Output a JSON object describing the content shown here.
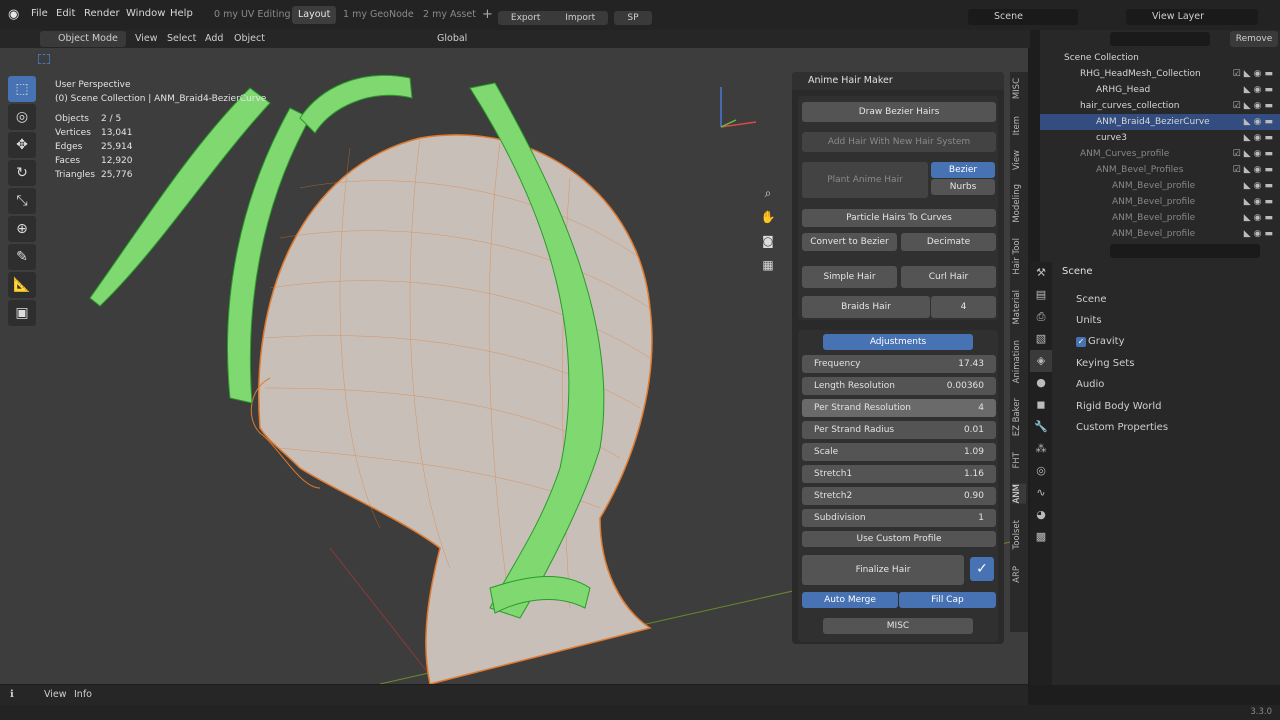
{
  "app": {
    "blender_icon": "blender-logo-icon",
    "version": "3.3.0"
  },
  "menu": [
    "File",
    "Edit",
    "Render",
    "Window",
    "Help"
  ],
  "workspaces": [
    {
      "label": "0 my UV Editing",
      "active": false
    },
    {
      "label": "Layout",
      "active": true
    },
    {
      "label": "1 my GeoNode",
      "active": false
    },
    {
      "label": "2 my Asset",
      "active": false
    }
  ],
  "top_buttons": {
    "add": "+",
    "export": "Export",
    "import": "Import",
    "sp": "SP"
  },
  "scene_selector": {
    "label": "Scene"
  },
  "view_layer": {
    "label": "View Layer"
  },
  "outliner_search_placeholder": "",
  "remove_label": "Remove",
  "viewport_header": {
    "mode": "Object Mode",
    "menus": [
      "View",
      "Select",
      "Add",
      "Object"
    ],
    "transform": "Global"
  },
  "stats": {
    "perspective": "User Perspective",
    "collection": "(0) Scene Collection | ANM_Braid4-BezierCurve",
    "rows": [
      [
        "Objects",
        "2 / 5"
      ],
      [
        "Vertices",
        "13,041"
      ],
      [
        "Edges",
        "25,914"
      ],
      [
        "Faces",
        "12,920"
      ],
      [
        "Triangles",
        "25,776"
      ]
    ]
  },
  "panel": {
    "title": "Anime Hair Maker",
    "draw_bezier": "Draw Bezier Hairs",
    "add_hair": "Add Hair With New Hair System",
    "plant": "Plant Anime Hair",
    "bezier": "Bezier",
    "nurbs": "Nurbs",
    "particle": "Particle Hairs To Curves",
    "convert": "Convert to Bezier",
    "decimate": "Decimate",
    "simple": "Simple Hair",
    "curl": "Curl Hair",
    "braids": "Braids Hair",
    "braids_count": "4",
    "adjustments": "Adjustments",
    "props": [
      [
        "Frequency",
        "17.43"
      ],
      [
        "Length Resolution",
        "0.00360"
      ],
      [
        "Per Strand Resolution",
        "4"
      ],
      [
        "Per Strand Radius",
        "0.01"
      ],
      [
        "Scale",
        "1.09"
      ],
      [
        "Stretch1",
        "1.16"
      ],
      [
        "Stretch2",
        "0.90"
      ],
      [
        "Subdivision",
        "1"
      ]
    ],
    "custom_profile": "Use Custom Profile",
    "finalize": "Finalize Hair",
    "auto_merge": "Auto Merge",
    "fill_cap": "Fill Cap",
    "misc": "MISC"
  },
  "side_tabs": [
    "MISC",
    "Item",
    "View",
    "Modeling",
    "Hair Tool",
    "Material",
    "Animation",
    "EZ Baker",
    "FHT",
    "ANM",
    "Toolset",
    "ARP"
  ],
  "outliner": [
    {
      "label": "Scene Collection",
      "indent": 0,
      "sel": false
    },
    {
      "label": "RHG_HeadMesh_Collection",
      "indent": 1,
      "sel": false
    },
    {
      "label": "ARHG_Head",
      "indent": 2,
      "sel": false
    },
    {
      "label": "hair_curves_collection",
      "indent": 1,
      "sel": false
    },
    {
      "label": "ANM_Braid4_BezierCurve",
      "indent": 2,
      "sel": true
    },
    {
      "label": "curve3",
      "indent": 2,
      "sel": false
    },
    {
      "label": "ANM_Curves_profile",
      "indent": 1,
      "sel": false
    },
    {
      "label": "ANM_Bevel_Profiles",
      "indent": 2,
      "sel": false
    },
    {
      "label": "ANM_Bevel_profile",
      "indent": 3,
      "sel": false
    },
    {
      "label": "ANM_Bevel_profile",
      "indent": 3,
      "sel": false
    },
    {
      "label": "ANM_Bevel_profile",
      "indent": 3,
      "sel": false
    },
    {
      "label": "ANM_Bevel_profile",
      "indent": 3,
      "sel": false
    }
  ],
  "properties": {
    "title": "Scene",
    "rows": [
      "Scene",
      "Units",
      "Gravity",
      "Keying Sets",
      "Audio",
      "Rigid Body World",
      "Custom Properties"
    ]
  },
  "bottom": {
    "view": "View",
    "info": "Info"
  },
  "colors": {
    "accent": "#4772b3",
    "hair": "#3fbf3f",
    "wire": "#e07a2e"
  }
}
